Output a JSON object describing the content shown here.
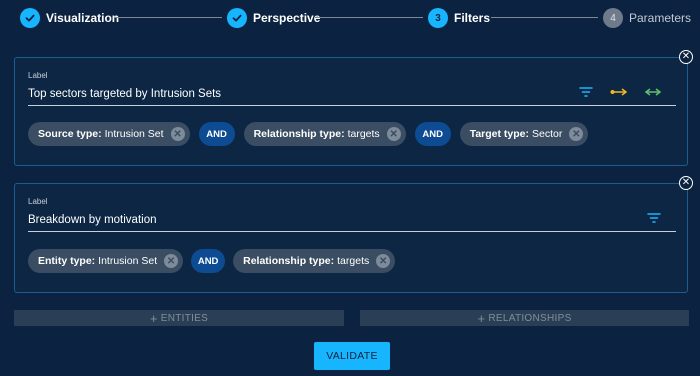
{
  "stepper": {
    "steps": [
      {
        "label": "Visualization",
        "state": "done",
        "icon": "check-icon"
      },
      {
        "label": "Perspective",
        "state": "done",
        "icon": "check-icon"
      },
      {
        "label": "Filters",
        "state": "active",
        "number": "3"
      },
      {
        "label": "Parameters",
        "state": "todo",
        "number": "4"
      }
    ]
  },
  "filters": [
    {
      "label_caption": "Label",
      "label_value": "Top sectors targeted by Intrusion Sets",
      "icons": [
        "filter-icon",
        "from-to-arrow-icon",
        "bidirectional-arrow-icon"
      ],
      "chips": [
        {
          "key": "Source type:",
          "value": "Intrusion Set"
        },
        {
          "key": "Relationship type:",
          "value": "targets"
        },
        {
          "key": "Target type:",
          "value": "Sector"
        }
      ],
      "operator": "AND"
    },
    {
      "label_caption": "Label",
      "label_value": "Breakdown by motivation",
      "icons": [
        "filter-icon"
      ],
      "chips": [
        {
          "key": "Entity type:",
          "value": "Intrusion Set"
        },
        {
          "key": "Relationship type:",
          "value": "targets"
        }
      ],
      "operator": "AND"
    }
  ],
  "actions": {
    "add_entities": "ENTITIES",
    "add_relationships": "RELATIONSHIPS",
    "validate": "VALIDATE"
  },
  "colors": {
    "background": "#0b2340",
    "accent": "#18b5ff",
    "chip": "#3a4d63",
    "operator": "#0d4c93",
    "arrow_orange": "#f5b622",
    "arrow_green": "#5fc26a"
  }
}
